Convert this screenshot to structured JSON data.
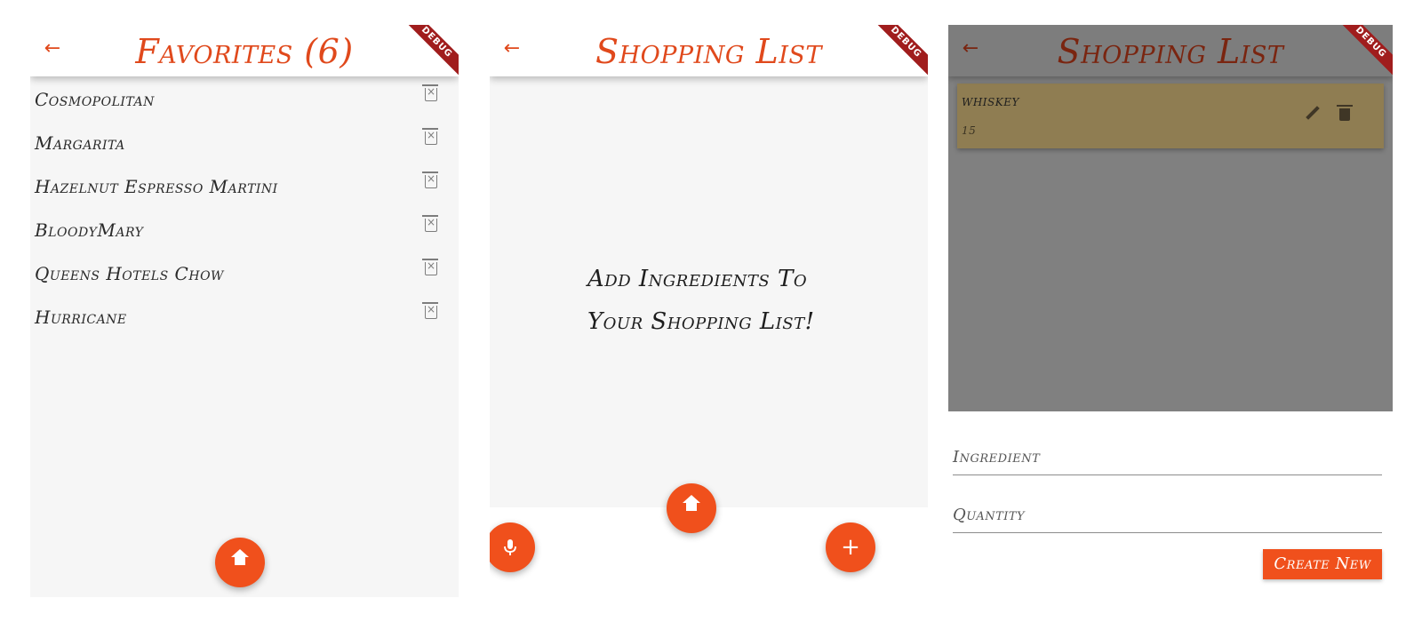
{
  "favorites_screen": {
    "title": "Favorites (6)",
    "debug_label": "DEBUG",
    "items": [
      {
        "name": "Cosmopolitan"
      },
      {
        "name": "Margarita"
      },
      {
        "name": "Hazelnut Espresso Martini"
      },
      {
        "name": "BloodyMary"
      },
      {
        "name": "Queens Hotels Chow"
      },
      {
        "name": "Hurricane"
      }
    ]
  },
  "shopping_empty_screen": {
    "title": "Shopping List",
    "debug_label": "DEBUG",
    "empty_message_line1": "Add Ingredients To",
    "empty_message_line2": "Your Shopping List!",
    "add_label": "+"
  },
  "shopping_form_screen": {
    "title": "Shopping List",
    "debug_label": "DEBUG",
    "item": {
      "name": "whiskey",
      "quantity": "15"
    },
    "ingredient_label": "Ingredient",
    "quantity_label": "Quantity",
    "create_button_label": "Create New"
  },
  "icons": {
    "back": "arrow-left-icon",
    "home": "home-icon",
    "delete": "delete-outline-icon",
    "mic": "microphone-icon",
    "edit": "pencil-icon",
    "trash": "trash-icon"
  },
  "colors": {
    "accent": "#f0501c",
    "title": "#e0491c",
    "debug_banner": "#a01d1d"
  }
}
